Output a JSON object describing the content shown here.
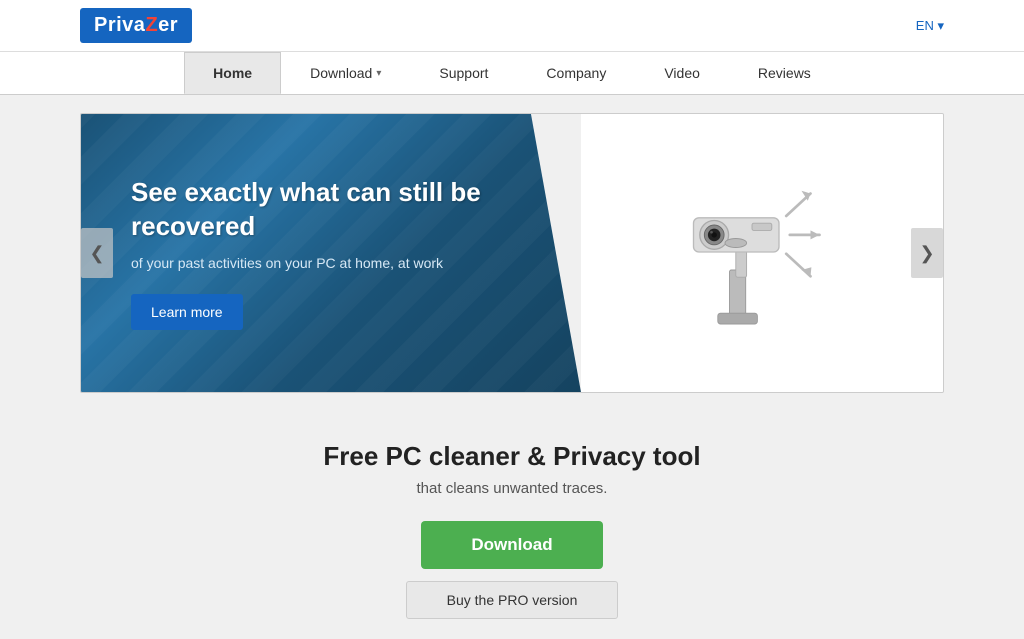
{
  "logo": {
    "text_before_z": "Priva",
    "z": "Z",
    "text_after_z": "er"
  },
  "lang": {
    "label": "EN",
    "caret": "▾"
  },
  "nav": {
    "items": [
      {
        "id": "home",
        "label": "Home",
        "active": true,
        "has_caret": false
      },
      {
        "id": "download",
        "label": "Download",
        "active": false,
        "has_caret": true
      },
      {
        "id": "support",
        "label": "Support",
        "active": false,
        "has_caret": false
      },
      {
        "id": "company",
        "label": "Company",
        "active": false,
        "has_caret": false
      },
      {
        "id": "video",
        "label": "Video",
        "active": false,
        "has_caret": false
      },
      {
        "id": "reviews",
        "label": "Reviews",
        "active": false,
        "has_caret": false
      }
    ]
  },
  "hero": {
    "title": "See exactly what can still be recovered",
    "subtitle": "of your past activities on your PC at home, at work",
    "learn_more_label": "Learn more",
    "arrow_left": "❮",
    "arrow_right": "❯"
  },
  "main": {
    "title": "Free PC cleaner & Privacy tool",
    "subtitle": "that cleans unwanted traces.",
    "download_label": "Download",
    "pro_label": "Buy the PRO version"
  }
}
